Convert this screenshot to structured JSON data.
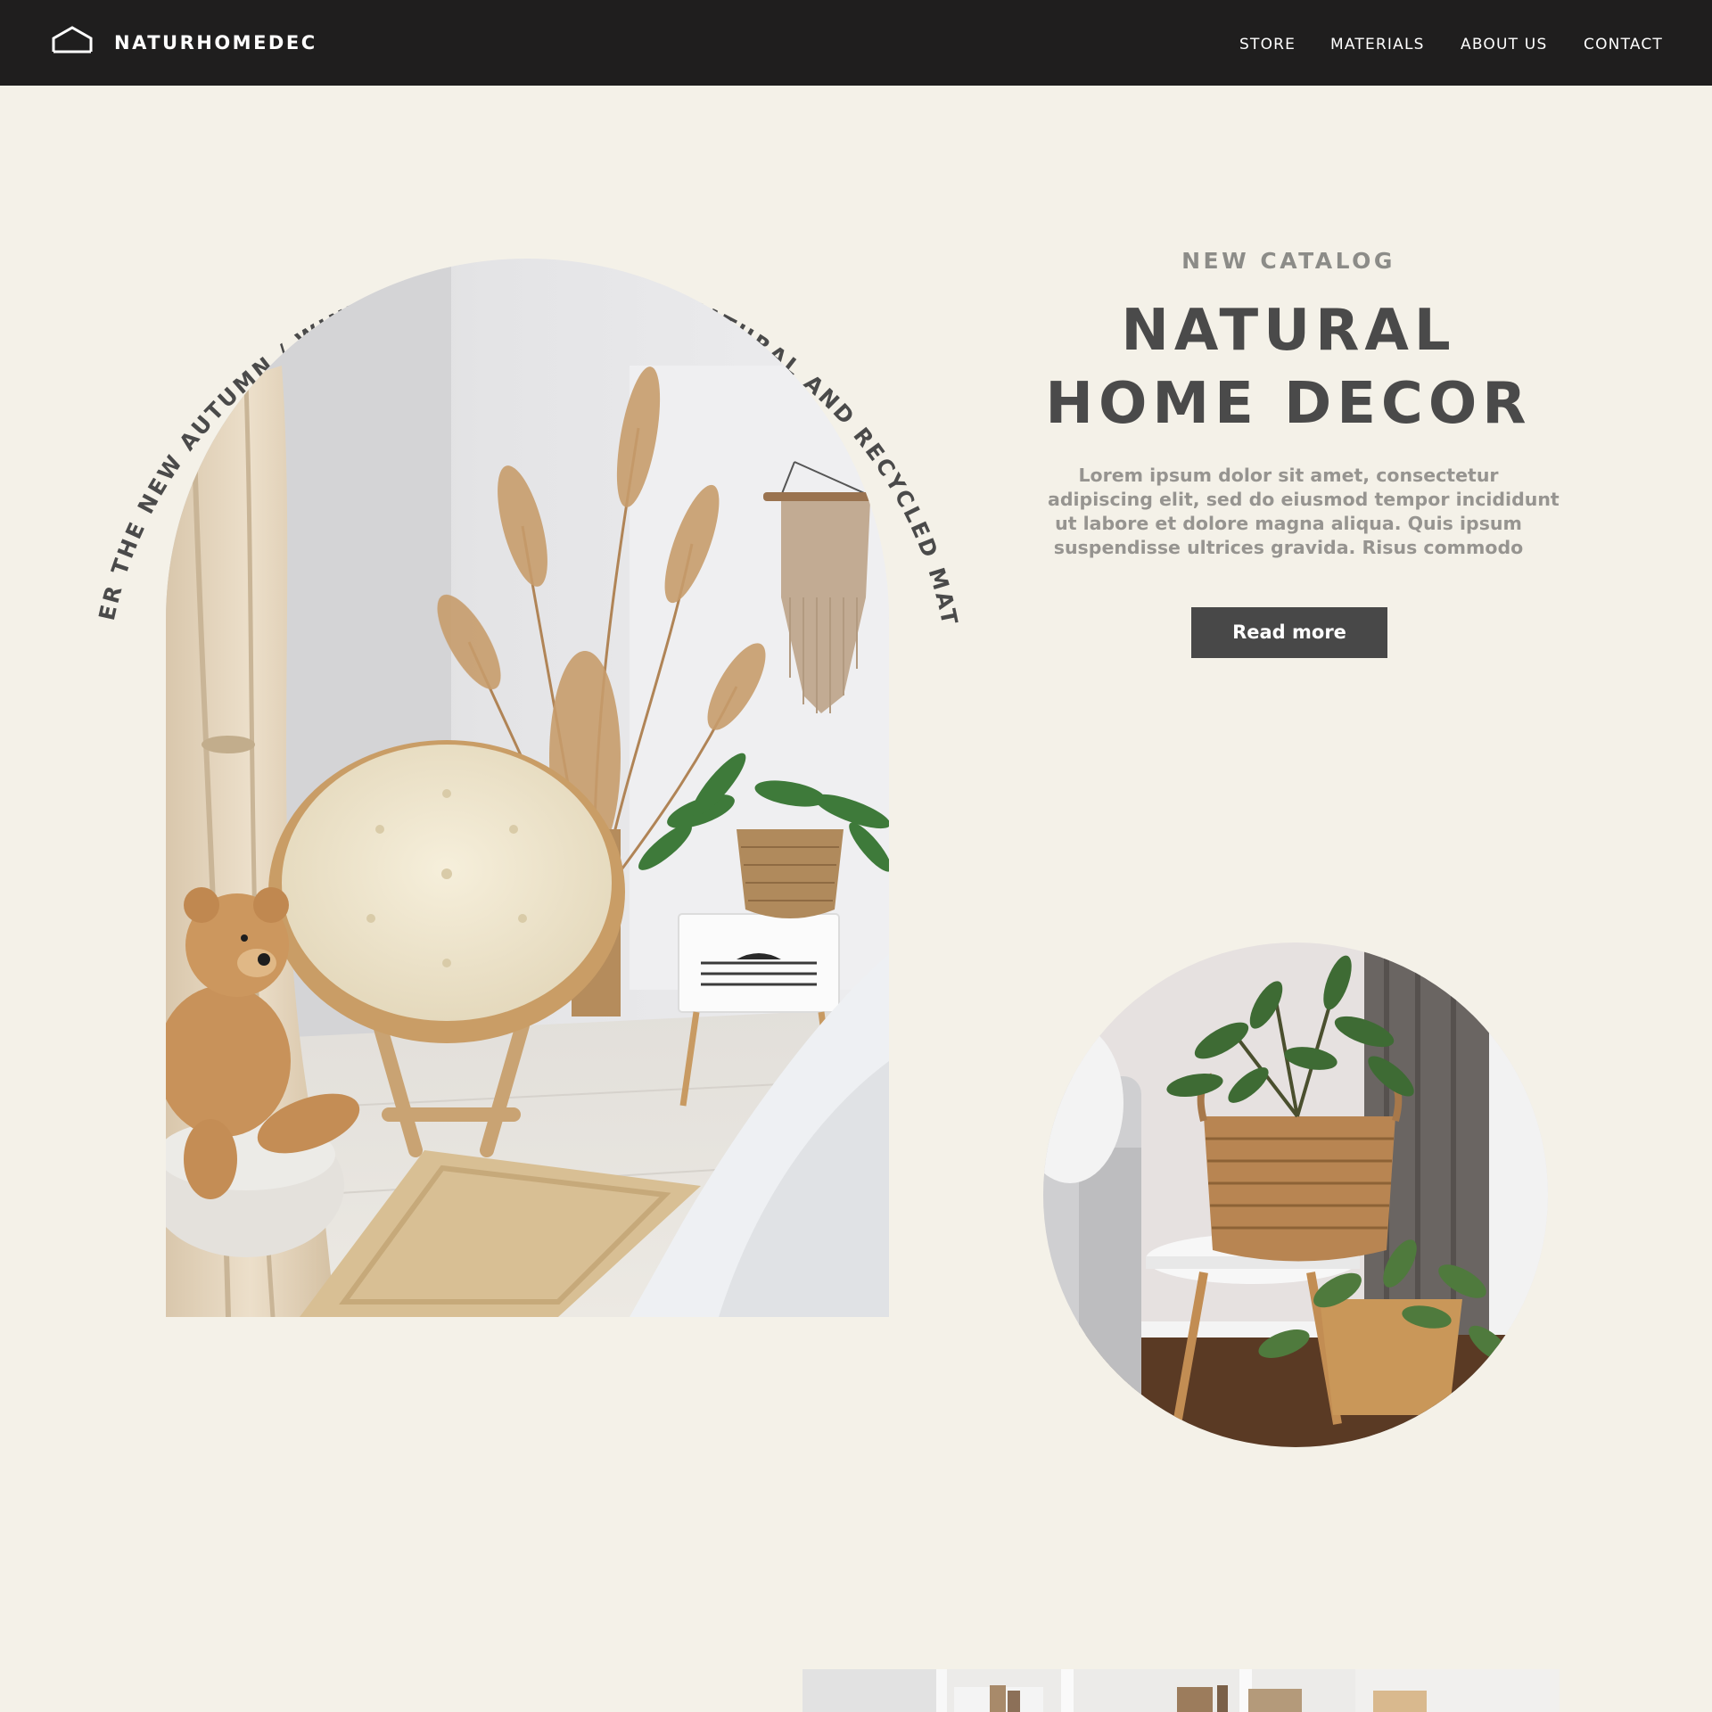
{
  "brand": {
    "name": "NATURHOMEDEC",
    "icon": "house-outline-icon"
  },
  "nav": {
    "items": [
      "STORE",
      "MATERIALS",
      "ABOUT US",
      "CONTACT"
    ]
  },
  "hero": {
    "arch_caption": "DISCOVER THE NEW AUTUMN / WINTER COLLECTION WITH NATURAL AND RECYCLED MATERIALS",
    "eyebrow": "NEW CATALOG",
    "title_line1": "NATURAL",
    "title_line2": "HOME DECOR",
    "body_lines": [
      "Lorem ipsum dolor sit amet, consectetur",
      "adipiscing elit, sed do eiusmod tempor incididunt",
      "ut labore et dolore magna aliqua. Quis ipsum",
      "suspendisse ultrices gravida. Risus commodo"
    ],
    "cta_label": "Read more"
  },
  "colors": {
    "page_background": "#f4f1e8",
    "nav_background": "#1f1e1e",
    "heading": "#4a4a4a",
    "muted_text": "#969490",
    "button": "#484848"
  }
}
